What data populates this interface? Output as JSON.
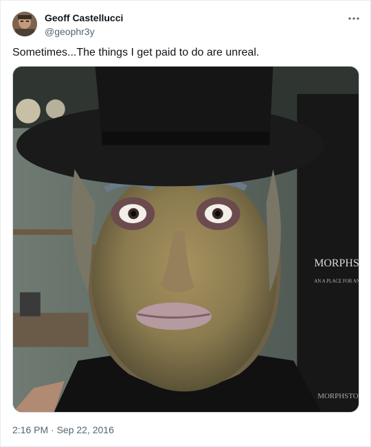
{
  "author": {
    "name": "Geoff Castellucci",
    "handle": "@geophr3y",
    "avatar_icon": "user-avatar"
  },
  "tweet": {
    "text": "Sometimes...The things I get paid to do are unreal.",
    "timestamp": "2:16 PM · Sep 22, 2016"
  },
  "media": {
    "kind": "photo",
    "poster_text_line1": "MORPHSTO",
    "poster_text_line2": "AN A PLACE FOR AN O",
    "poster_text_line3": "MORPHSTO"
  },
  "colors": {
    "text_primary": "#0f1419",
    "text_secondary": "#536471",
    "border": "#cfd9de"
  },
  "icons": {
    "more": "more-horizontal-icon"
  }
}
